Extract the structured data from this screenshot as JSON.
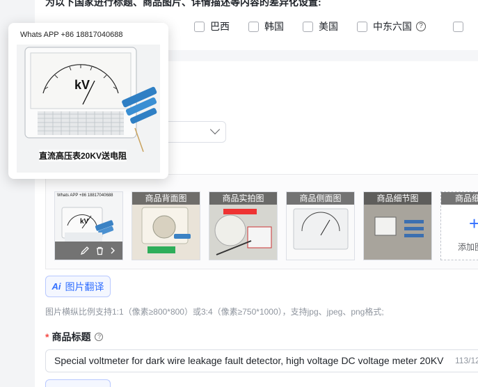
{
  "settings": {
    "heading": "为以下国家进行标题、商品图片、详情描述等内容的差异化设置:",
    "countries": [
      {
        "label": "巴西"
      },
      {
        "label": "韩国"
      },
      {
        "label": "美国"
      },
      {
        "label": "中东六国"
      }
    ]
  },
  "popover": {
    "watermark": "Whats APP +86 18817040688",
    "caption": "直流高压表20KV送电阻",
    "meter_unit": "kV"
  },
  "gallery": {
    "thumbnails": [
      {
        "label": ""
      },
      {
        "label": "商品背面图"
      },
      {
        "label": "商品实拍图"
      },
      {
        "label": "商品侧面图"
      },
      {
        "label": "商品细节图"
      },
      {
        "label": "商品细"
      }
    ],
    "add_label": "添加图",
    "translate_label": "图片翻译",
    "translate_icon_text": "Ai",
    "hint": "图片横纵比例支持1:1（像素≥800*800）或3:4（像素≥750*1000），支持jpg、jpeg、png格式;"
  },
  "title_field": {
    "required_mark": "*",
    "label": "商品标题",
    "value": "Special voltmeter for dark wire leakage fault detector, high voltage DC voltage meter 20KV",
    "counter": "113/12"
  },
  "icons": {
    "edit": "pencil-icon",
    "delete": "trash-icon",
    "next": "chevron-right-icon",
    "help": "question-circle-icon",
    "plus": "plus-icon"
  },
  "colors": {
    "accent": "#3370ff",
    "required": "#f54a45",
    "hint_text": "#8f959e"
  }
}
